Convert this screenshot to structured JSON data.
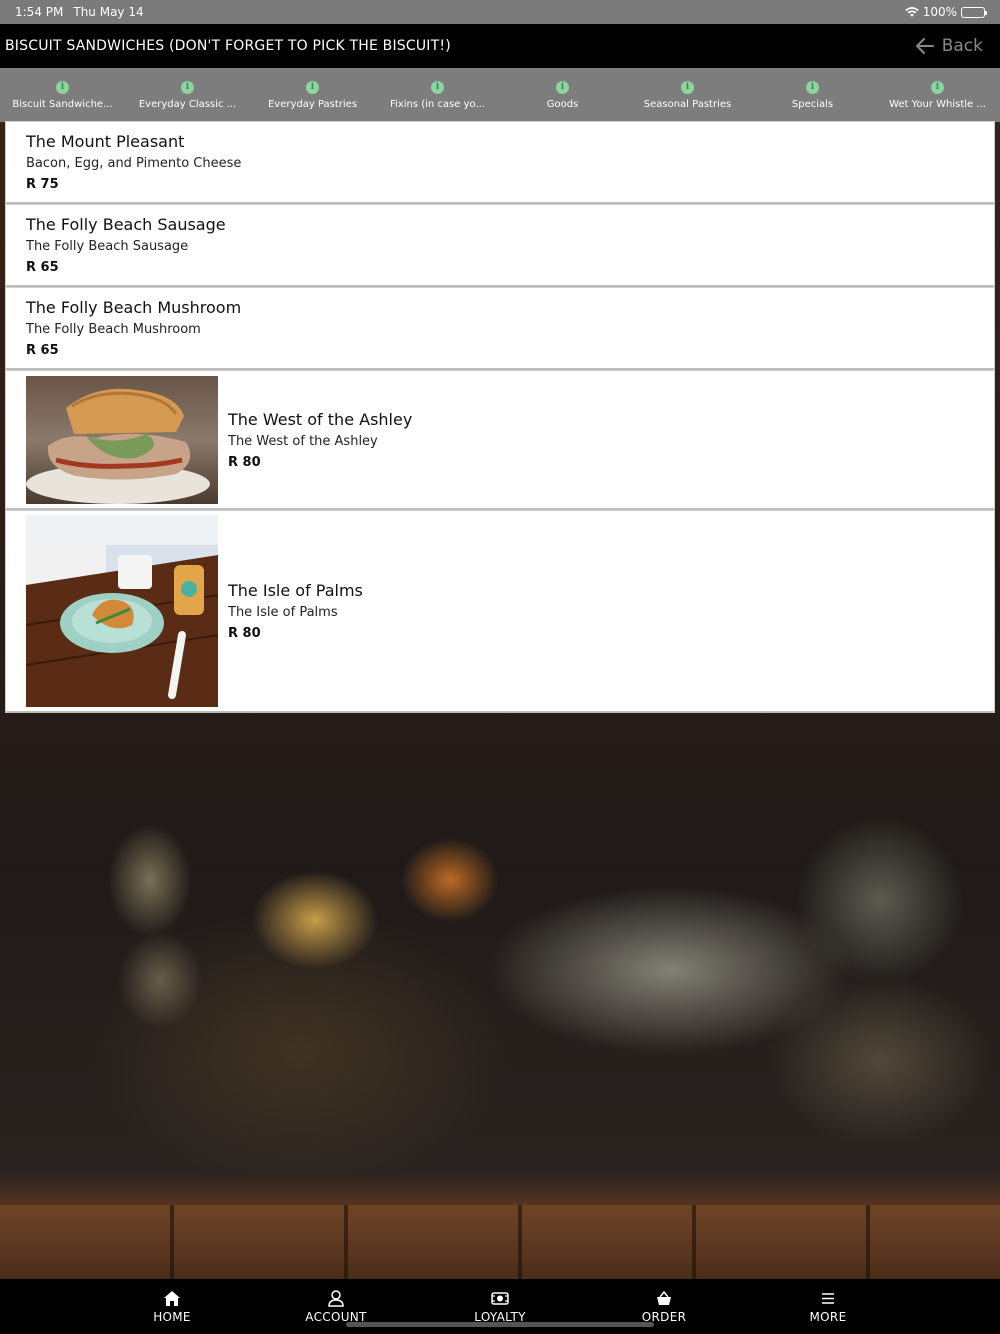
{
  "status_bar": {
    "time": "1:54 PM",
    "date": "Thu May 14",
    "battery": "100%"
  },
  "header": {
    "title": "BISCUIT SANDWICHES (DON'T FORGET TO PICK THE BISCUIT!)",
    "back_label": "Back"
  },
  "tabs": [
    {
      "label": "Biscuit Sandwiche..."
    },
    {
      "label": "Everyday Classic ..."
    },
    {
      "label": "Everyday Pastries"
    },
    {
      "label": "Fixins (in case yo..."
    },
    {
      "label": "Goods"
    },
    {
      "label": "Seasonal Pastries"
    },
    {
      "label": "Specials"
    },
    {
      "label": "Wet Your Whistle ..."
    }
  ],
  "items": [
    {
      "name": "The Mount Pleasant",
      "description": "Bacon, Egg, and Pimento Cheese",
      "price": "R 75"
    },
    {
      "name": "The Folly Beach Sausage",
      "description": "The Folly Beach Sausage",
      "price": "R 65"
    },
    {
      "name": "The Folly Beach Mushroom",
      "description": "The Folly Beach Mushroom",
      "price": "R 65"
    },
    {
      "name": "The West of the Ashley",
      "description": "The West of the Ashley",
      "price": "R 80"
    },
    {
      "name": "The Isle of Palms",
      "description": "The Isle of Palms",
      "price": "R 80"
    }
  ],
  "bottom_nav": [
    {
      "label": "HOME",
      "icon": "home-icon"
    },
    {
      "label": "ACCOUNT",
      "icon": "person-icon"
    },
    {
      "label": "LOYALTY",
      "icon": "loyalty-icon"
    },
    {
      "label": "ORDER",
      "icon": "basket-icon"
    },
    {
      "label": "MORE",
      "icon": "menu-icon"
    }
  ],
  "colors": {
    "header_bg": "#000000",
    "tab_bar_bg": "#7d7d7d",
    "info_icon": "#8fd3a0"
  }
}
